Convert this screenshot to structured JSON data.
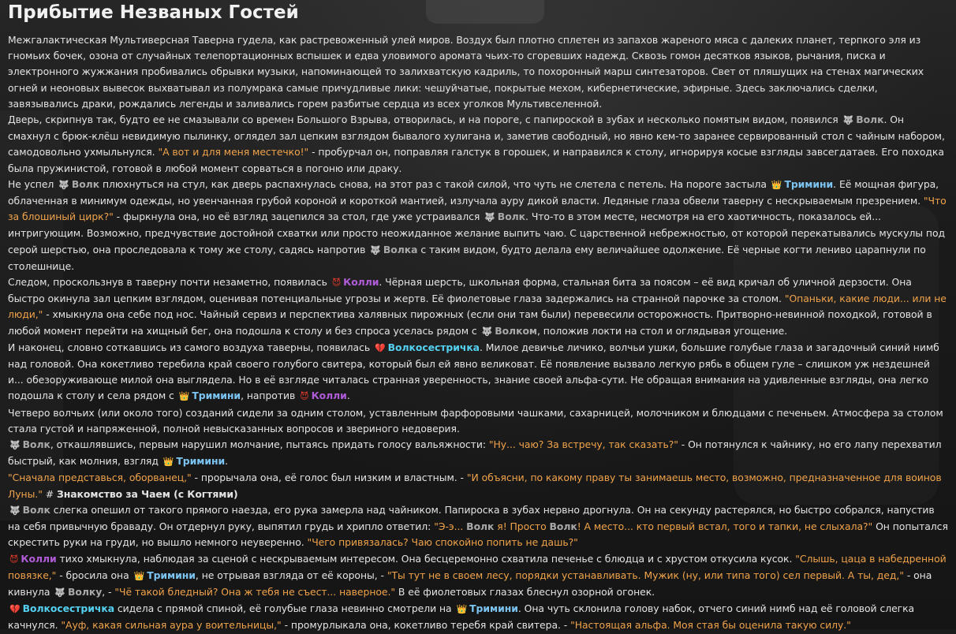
{
  "title": "Прибытие Незваных Гостей",
  "characters": {
    "wolf": "Волк",
    "wolf_instr": "Волком",
    "wolf_gen": "Волка",
    "wolf_dat": "Волку",
    "trimini": "Тримини",
    "kolli": "Колли",
    "volk": "Волкосестричка"
  },
  "p1": {
    "t1": "Межгалактическая Мультиверсная Таверна гудела, как растревоженный улей миров. Воздух был плотно сплетен из запахов жареного мяса с далеких планет, терпкого эля из гномьих бочек, озона от случайных телепортационных вспышек и едва уловимого аромата чьих-то сгоревших надежд. Сквозь гомон десятков языков, рычания, писка и электронного жужжания пробивались обрывки музыки, напоминающей то залихватскую кадриль, то похоронный марш синтезаторов. Свет от пляшущих на стенах магических огней и неоновых вывесок выхватывал из полумрака самые причудливые лики: чешуйчатые, покрытые мехом, кибернетические, эфирные. Здесь заключались сделки, завязывались драки, рождались легенды и заливались горем разбитые сердца из всех уголков Мультивселенной."
  },
  "p2": {
    "t1": "Дверь, скрипнув так, будто ее не смазывали со времен Большого Взрыва, отворилась, и на пороге, с папироской в зубах и несколько помятым видом, появился ",
    "t2": ". Он смахнул с брюк-клёш невидимую пылинку, оглядел зал цепким взглядом бывалого хулигана и, заметив свободный, но явно кем-то заранее сервированный стол с чайным набором, самодовольно ухмыльнулся. ",
    "q1": "\"А вот и для меня местечко!\"",
    "t3": " - пробурчал он, поправляя галстук в горошек, и направился к столу, игнорируя косые взгляды завсегдатаев. Его походка была пружинистой, готовой в любой момент сорваться в погоню или драку."
  },
  "p3": {
    "t1": "Не успел ",
    "t2": " плюхнуться на стул, как дверь распахнулась снова, на этот раз с такой силой, что чуть не слетела с петель. На пороге застыла ",
    "t3": ". Её мощная фигура, облаченная в минимум одежды, но увенчанная грубой короной и короткой мантией, излучала ауру дикой власти. Ледяные глаза обвели таверну с нескрываемым презрением. ",
    "q1": "\"Что за блошиный цирк?\"",
    "t4": " - фыркнула она, но её взгляд зацепился за стол, где уже устраивался ",
    "t5": ". Что-то в этом месте, несмотря на его хаотичность, показалось ей... интригующим. Возможно, предчувствие достойной схватки или просто неожиданное желание выпить чаю. С царственной небрежностью, от которой перекатывались мускулы под серой шерстью, она проследовала к тому же столу, садясь напротив ",
    "t6": " с таким видом, будто делала ему величайшее одолжение. Её черные когти лениво царапнули по столешнице."
  },
  "p4": {
    "t1": "Следом, проскользнув в таверну почти незаметно, появилась ",
    "t2": ". Чёрная шерсть, школьная форма, стальная бита за поясом – её вид кричал об уличной дерзости. Она быстро окинула зал цепким взглядом, оценивая потенциальные угрозы и жертв. Её фиолетовые глаза задержались на странной парочке за столом. ",
    "q1": "\"Опаньки, какие люди... или не люди,\"",
    "t3": " - хмыкнула она себе под нос. Чайный сервиз и перспектива халявных пирожных (если они там были) перевесили осторожность. Притворно-невинной походкой, готовой в любой момент перейти на хищный бег, она подошла к столу и без спроса уселась рядом с ",
    "t4": ", положив локти на стол и оглядывая угощение."
  },
  "p5": {
    "t1": "И наконец, словно соткавшись из самого воздуха таверны, появилась ",
    "t2": ". Милое девичье личико, волчьи ушки, большие голубые глаза и загадочный синий нимб над головой. Она кокетливо теребила край своего голубого свитера, который был ей явно великоват. Её появление вызвало легкую рябь в общем гуле – слишком уж нездешней и... обезоруживающе милой она выглядела. Но в её взгляде читалась странная уверенность, знание своей альфа-сути. Не обращая внимания на удивленные взгляды, она легко подошла к столу и села рядом с ",
    "t3": ", напротив ",
    "t4": "."
  },
  "p6": {
    "t1": "Четверо волчьих (или около того) созданий сидели за одним столом, уставленным фарфоровыми чашками, сахарницей, молочником и блюдцами с печеньем. Атмосфера за столом стала густой и напряженной, полной невысказанных вопросов и звериного недоверия."
  },
  "p7": {
    "t1": ", откашлявшись, первым нарушил молчание, пытаясь придать голосу вальяжности: ",
    "q1": "\"Ну... чаю? За встречу, так сказать?\"",
    "t2": " - Он потянулся к чайнику, но его лапу перехватил быстрый, как молния, взгляд ",
    "t3": "."
  },
  "p8": {
    "q1": "\"Сначала представься, оборванец,\"",
    "t1": " - прорычала она, её голос был низким и властным. - ",
    "q2": "\"И объясни, по какому праву ты занимаешь место, возможно, предназначенное для воинов Луны.\"",
    "t2": " # ",
    "h1": "Знакомство за Чаем (с Когтями)"
  },
  "p9": {
    "t1": " слегка опешил от такого прямого наезда, его рука замерла над чайником. Папироска в зубах нервно дрогнула. Он на секунду растерялся, но быстро собрался, напустив на себя привычную браваду. Он отдернул руку, выпятил грудь и хрипло ответил: ",
    "q1": "\"Э-э... ",
    "q2": " я! Просто ",
    "q3": "! А место... кто первый встал, того и тапки, не слыхала?\"",
    "t2": " Он попытался скрестить руки на груди, но вышло немного неуверенно. ",
    "q4": "\"Чего привязалась? Чаю спокойно попить не дашь?\""
  },
  "p10": {
    "t1": " тихо хмыкнула, наблюдая за сценой с нескрываемым интересом. Она бесцеремонно схватила печенье с блюдца и с хрустом откусила кусок. ",
    "q1": "\"Слышь, цаца в набедренной повязке,\"",
    "t2": " - бросила она ",
    "t3": ", не отрывая взгляда от её короны, - ",
    "q2": "\"Ты тут не в своем лесу, порядки устанавливать. Мужик (ну, или типа того) сел первый. А ты, дед,\"",
    "t4": " - она кивнула ",
    "t5": ", - ",
    "q3": "\"Чё такой бледный? Она ж тебя не съест... наверное.\"",
    "t6": " В её фиолетовых глазах блеснул озорной огонек."
  },
  "p11": {
    "t1": " сидела с прямой спиной, её голубые глаза невинно смотрели на ",
    "t2": ". Она чуть склонила голову набок, отчего синий нимб над её головой слегка качнулся. ",
    "q1": "\"Ауф, какая сильная аура у воительницы,\"",
    "t3": " - промурлыкала она, кокетливо теребя край свитера. - ",
    "q2": "\"Настоящая альфа. Моя стая бы оценила такую силу.\""
  },
  "icons": {
    "wolf": "wolf-icon",
    "crown": "crown-icon",
    "devil": "devil-icon",
    "heart": "broken-heart-icon"
  }
}
